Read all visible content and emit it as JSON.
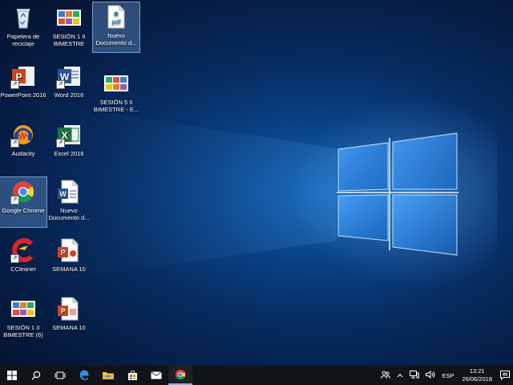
{
  "desktop_icons": [
    {
      "label": "Papelera de reciclaje",
      "icon": "recycle-bin-icon"
    },
    {
      "label": "SESIÓN 1 II BIMESTRE",
      "icon": "image-file-icon"
    },
    {
      "label": "Nuevo Documento d...",
      "icon": "pdf-file-icon"
    },
    {
      "label": "PowerPoint 2016",
      "icon": "powerpoint-icon"
    },
    {
      "label": "Word 2016",
      "icon": "word-icon"
    },
    {
      "label": "SESIÓN 5 II BIMESTRE - E...",
      "icon": "image-file-icon"
    },
    {
      "label": "Audacity",
      "icon": "audacity-icon"
    },
    {
      "label": "Excel 2016",
      "icon": "excel-icon"
    },
    {
      "label": "Google Chrome",
      "icon": "chrome-icon"
    },
    {
      "label": "Nuevo Documento d...",
      "icon": "word-document-icon"
    },
    {
      "label": "CCleaner",
      "icon": "ccleaner-icon"
    },
    {
      "label": "SEMANA 10",
      "icon": "powerpoint-file-icon"
    },
    {
      "label": "SESIÓN 1 II BIMESTRE (6)",
      "icon": "image-file-icon"
    },
    {
      "label": "SEMANA 10",
      "icon": "powerpoint-file-icon"
    }
  ],
  "taskbar": {
    "icons": [
      "start-icon",
      "search-icon",
      "task-view-icon",
      "edge-icon",
      "file-explorer-icon",
      "store-icon",
      "mail-icon",
      "chrome-icon"
    ],
    "language": "ESP",
    "time": "13:21",
    "date": "26/06/2018"
  },
  "colors": {
    "taskbar": "#101317",
    "accent": "#7bb3f0",
    "wallpaper": "#0a3f82"
  }
}
